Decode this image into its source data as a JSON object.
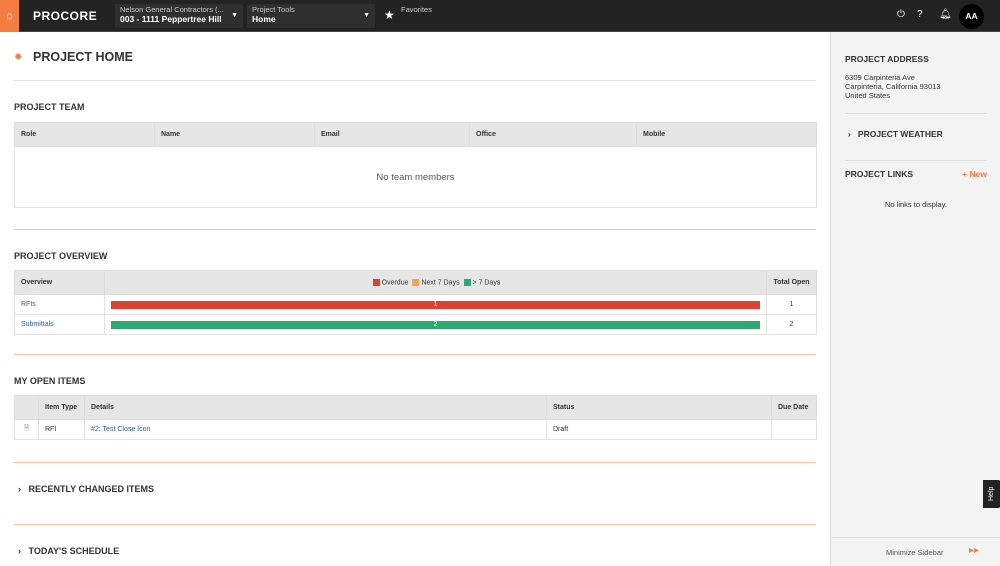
{
  "topbar": {
    "logo": "PROCORE",
    "company": "Nelson General Contractors (...",
    "project": "003 - 1111 Peppertree Hill",
    "tools_label": "Project Tools",
    "tool": "Home",
    "favorites": "Favorites",
    "avatar": "AA",
    "accent": "#f47e42"
  },
  "main": {
    "title": "PROJECT HOME",
    "team": {
      "title": "PROJECT TEAM",
      "columns": [
        "Role",
        "Name",
        "Email",
        "Office",
        "Mobile"
      ],
      "empty": "No team members"
    },
    "overview": {
      "title": "PROJECT OVERVIEW",
      "col_overview": "Overview",
      "col_total": "Total Open",
      "legend": [
        {
          "label": "Overdue",
          "color": "#dc4234"
        },
        {
          "label": "Next 7 Days",
          "color": "#f5a45b"
        },
        {
          "label": "> 7 Days",
          "color": "#2fa872"
        }
      ],
      "rows": [
        {
          "name": "RFIs",
          "bar_value": "1",
          "color": "#dc4234",
          "total": "1"
        },
        {
          "name": "Submittals",
          "bar_value": "2",
          "color": "#2fa872",
          "total": "2"
        }
      ]
    },
    "open_items": {
      "title": "MY OPEN ITEMS",
      "columns": [
        "Item Type",
        "Details",
        "Status",
        "Due Date"
      ],
      "rows": [
        {
          "type": "RFI",
          "details": "#2: Test Close Icon",
          "status": "Draft",
          "due": ""
        }
      ]
    },
    "recent": "RECENTLY CHANGED ITEMS",
    "schedule": "TODAY'S SCHEDULE"
  },
  "sidebar": {
    "address_title": "PROJECT ADDRESS",
    "address": [
      "6309 Carpinteria Ave",
      "Carpinteria, California 93013",
      "United States"
    ],
    "weather": "PROJECT WEATHER",
    "links_title": "PROJECT LINKS",
    "new": "+ New",
    "no_links": "No links to display.",
    "minimize": "Minimize Sidebar",
    "help": "Help"
  }
}
